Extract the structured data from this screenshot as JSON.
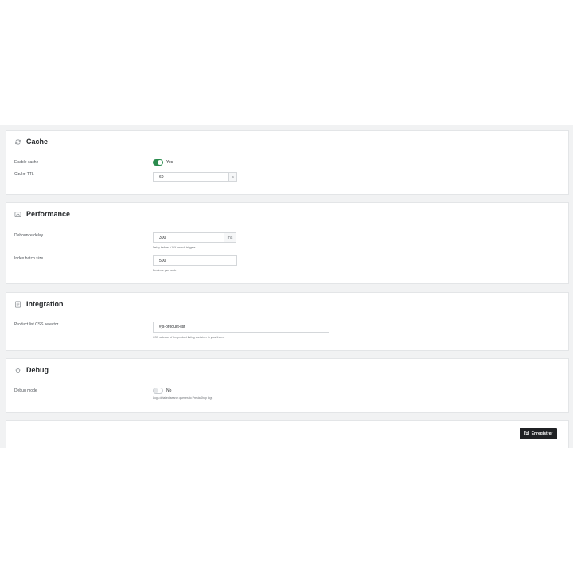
{
  "sections": {
    "cache": {
      "title": "Cache",
      "icon": "refresh-icon",
      "enable_label": "Enable cache",
      "enable_value": "Yes",
      "enabled": true,
      "ttl_label": "Cache TTL",
      "ttl_value": "60",
      "ttl_unit": "s"
    },
    "performance": {
      "title": "Performance",
      "icon": "gauge-icon",
      "debounce_label": "Debounce delay",
      "debounce_value": "300",
      "debounce_unit": "ms",
      "debounce_help": "Delay before AJAX search triggers",
      "batch_label": "Index batch size",
      "batch_value": "500",
      "batch_help": "Products per batch"
    },
    "integration": {
      "title": "Integration",
      "icon": "document-icon",
      "selector_label": "Product list CSS selector",
      "selector_value": "#js-product-list",
      "selector_help": "CSS selector of the product listing container in your theme"
    },
    "debug": {
      "title": "Debug",
      "icon": "bug-icon",
      "mode_label": "Debug mode",
      "mode_value": "No",
      "enabled": false,
      "mode_help": "Logs detailed search queries to PrestaShop logs"
    }
  },
  "footer": {
    "save_label": "Enregistrer",
    "save_icon": "save-icon"
  },
  "colors": {
    "toggle_on": "#2a8b4d",
    "button_bg": "#1f2124",
    "panel_bg": "#f1f2f3"
  }
}
